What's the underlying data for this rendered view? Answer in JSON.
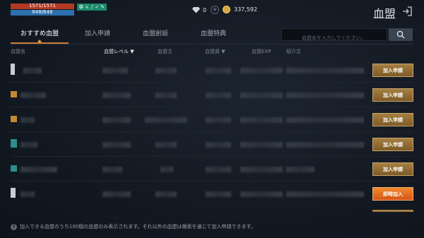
{
  "status": {
    "hp": "1571/1571",
    "mp": "648/648",
    "buffs": [
      "❂",
      "⚔",
      "♪",
      "✓",
      "✎"
    ]
  },
  "currency": {
    "gems": "0",
    "gold": "337,592"
  },
  "page_title": "血盟",
  "tabs": [
    {
      "label": "おすすめ血盟",
      "active": true
    },
    {
      "label": "加入申請",
      "active": false
    },
    {
      "label": "血盟創設",
      "active": false
    },
    {
      "label": "血盟特典",
      "active": false
    }
  ],
  "search": {
    "placeholder": "血盟名を入力してください。",
    "value": ""
  },
  "columns": {
    "name": "血盟名",
    "level": "血盟レベル ▼",
    "master": "血盟主",
    "members": "血盟員 ▼",
    "exp": "血盟EXP",
    "intro": "紹介文"
  },
  "rows": [
    {
      "emblem_color": "#c9ccd2",
      "action": "加入申請"
    },
    {
      "emblem_color": "#c28a2e",
      "action": "加入申請"
    },
    {
      "emblem_color": "#c28a2e",
      "action": "加入申請"
    },
    {
      "emblem_color": "#2a8f8a",
      "action": "加入申請"
    },
    {
      "emblem_color": "#2a8f8a",
      "action": "加入申請"
    },
    {
      "emblem_color": "#c9ccd2",
      "action": "即時加入"
    }
  ],
  "footer": {
    "note": "加入できる血盟のうち100個の血盟のみ表示されます。それ以外の血盟は検索を通じて加入申請できます。"
  }
}
